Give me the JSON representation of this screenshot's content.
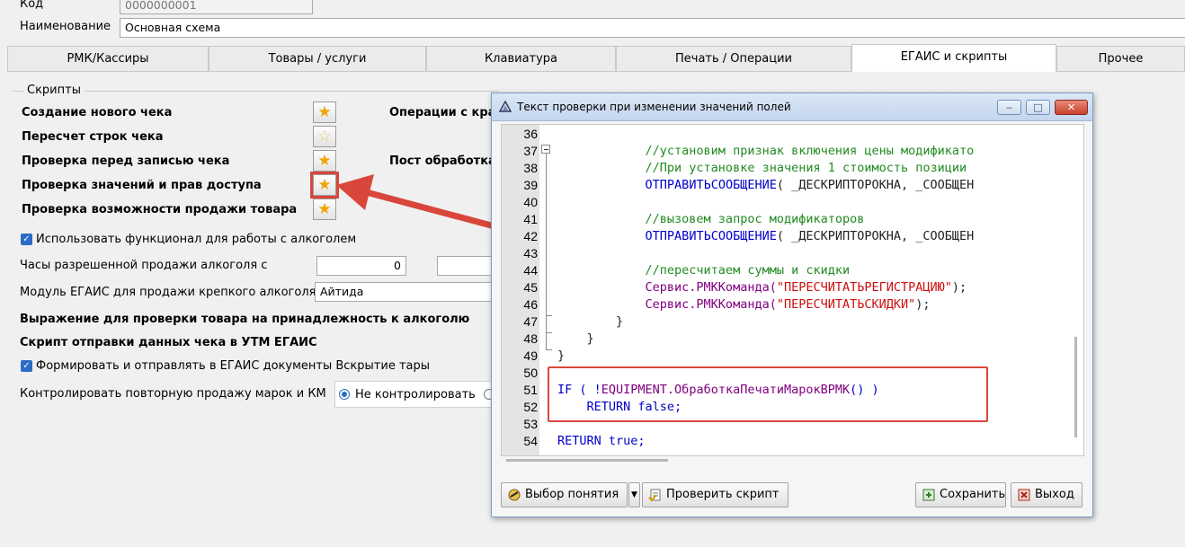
{
  "form": {
    "code_label": "Код",
    "code_value": "0000000001",
    "name_label": "Наименование",
    "name_value": "Основная схема"
  },
  "tabs": [
    {
      "label": "РМК/Кассиры"
    },
    {
      "label": "Товары / услуги"
    },
    {
      "label": "Клавиатура"
    },
    {
      "label": "Печать / Операции"
    },
    {
      "label": "ЕГАИС и скрипты"
    },
    {
      "label": "Прочее"
    }
  ],
  "scripts": {
    "group_title": "Скрипты",
    "items": [
      {
        "label": "Создание нового чека"
      },
      {
        "label": "Пересчет строк чека"
      },
      {
        "label": "Проверка перед записью чека"
      },
      {
        "label": "Проверка значений и прав доступа"
      },
      {
        "label": "Проверка возможности продажи товара"
      }
    ],
    "right_items": [
      {
        "label": "Операции с кра"
      },
      {
        "label": "Пост обработка"
      }
    ]
  },
  "alcohol": {
    "use_label": "Использовать функционал для работы с алкоголем",
    "hours_label": "Часы разрешенной продажи алкоголя с",
    "hours_from": "0",
    "hours_to": "",
    "module_label": "Модуль ЕГАИС для продажи крепкого алкоголя",
    "module_value": "Айтида",
    "expr_label": "Выражение для проверки товара на принадлежность к алкоголю",
    "send_label": "Скрипт отправки данных чека в УТМ ЕГАИС",
    "form_docs_label": "Формировать и отправлять в ЕГАИС документы Вскрытие тары",
    "control_label": "Контролировать повторную продажу марок и КМ",
    "control_option": "Не контролировать"
  },
  "dialog": {
    "title": "Текст проверки при изменении значений полей",
    "min_label": "‒",
    "max_label": "□",
    "close_label": "✕",
    "code_lines": [
      {
        "n": "36",
        "segs": []
      },
      {
        "n": "37",
        "segs": [
          {
            "t": "            //установим признак включения цены модификато",
            "c": "c-comment"
          }
        ]
      },
      {
        "n": "38",
        "segs": [
          {
            "t": "            //При установке значения 1 стоимость позиции ",
            "c": "c-comment"
          }
        ]
      },
      {
        "n": "39",
        "segs": [
          {
            "t": "            ",
            "c": ""
          },
          {
            "t": "ОТПРАВИТЬСООБЩЕНИЕ",
            "c": "c-kw"
          },
          {
            "t": "( _ДЕСКРИПТОРОКНА, _СООБЩЕН",
            "c": "c-dark"
          }
        ]
      },
      {
        "n": "40",
        "segs": []
      },
      {
        "n": "41",
        "segs": [
          {
            "t": "            //вызовем запрос модификаторов",
            "c": "c-comment"
          }
        ]
      },
      {
        "n": "42",
        "segs": [
          {
            "t": "            ",
            "c": ""
          },
          {
            "t": "ОТПРАВИТЬСООБЩЕНИЕ",
            "c": "c-kw"
          },
          {
            "t": "( _ДЕСКРИПТОРОКНА, _СООБЩЕН",
            "c": "c-dark"
          }
        ]
      },
      {
        "n": "43",
        "segs": []
      },
      {
        "n": "44",
        "segs": [
          {
            "t": "            //пересчитаем суммы и скидки",
            "c": "c-comment"
          }
        ]
      },
      {
        "n": "45",
        "segs": [
          {
            "t": "            Сервис.РМККоманда(",
            "c": "c-fn"
          },
          {
            "t": "\"ПЕРЕСЧИТАТЬРЕГИСТРАЦИЮ\"",
            "c": "c-str"
          },
          {
            "t": ");",
            "c": "c-dark"
          }
        ]
      },
      {
        "n": "46",
        "segs": [
          {
            "t": "            Сервис.РМККоманда(",
            "c": "c-fn"
          },
          {
            "t": "\"ПЕРЕСЧИТАТЬСКИДКИ\"",
            "c": "c-str"
          },
          {
            "t": ");",
            "c": "c-dark"
          }
        ]
      },
      {
        "n": "47",
        "segs": [
          {
            "t": "        }",
            "c": "c-dark"
          }
        ]
      },
      {
        "n": "48",
        "segs": [
          {
            "t": "    }",
            "c": "c-dark"
          }
        ]
      },
      {
        "n": "49",
        "segs": [
          {
            "t": "}",
            "c": "c-dark"
          }
        ]
      },
      {
        "n": "50",
        "segs": []
      },
      {
        "n": "51",
        "segs": [
          {
            "t": "IF ( !",
            "c": "c-kw"
          },
          {
            "t": "EQUIPMENT.ОбработкаПечатиМарокВРМК",
            "c": "c-fn"
          },
          {
            "t": "() )",
            "c": "c-kw"
          }
        ]
      },
      {
        "n": "52",
        "segs": [
          {
            "t": "    RETURN false;",
            "c": "c-kw"
          }
        ]
      },
      {
        "n": "53",
        "segs": []
      },
      {
        "n": "54",
        "segs": [
          {
            "t": "RETURN true;",
            "c": "c-kw"
          }
        ]
      }
    ],
    "buttons": {
      "choose": "Выбор понятия",
      "check": "Проверить скрипт",
      "save": "Сохранить",
      "exit": "Выход"
    }
  },
  "colors": {
    "accent": "#2b6cc4",
    "highlight_red": "#d9463b",
    "star": "#f0a500"
  }
}
